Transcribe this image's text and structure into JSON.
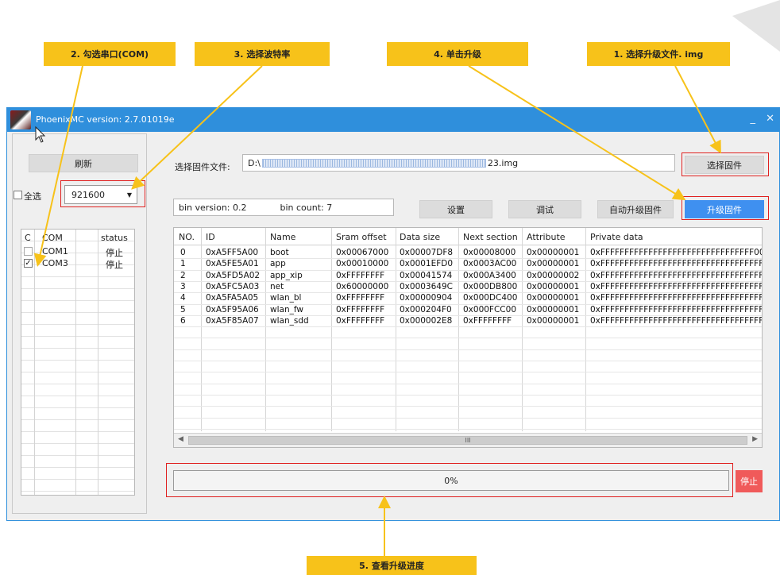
{
  "callouts": {
    "step1": "1. 选择升级文件. img",
    "step2": "2. 勾选串口(COM)",
    "step3": "3. 选择波特率",
    "step4": "4. 单击升级",
    "step5": "5. 查看升级进度"
  },
  "window": {
    "title": "PhoenixMC version: 2.7.01019e",
    "minimize": "_",
    "close": "✕"
  },
  "left_panel": {
    "refresh_label": "刷新",
    "select_all_label": "全选",
    "baud_rate": "921600",
    "columns": [
      "C",
      "COM",
      "status"
    ],
    "rows": [
      {
        "checked": false,
        "com": "COM1",
        "status": "停止"
      },
      {
        "checked": true,
        "com": "COM3",
        "status": "停止"
      }
    ]
  },
  "firmware": {
    "label": "选择固件文件:",
    "path_prefix": "D:\\",
    "path_suffix": "23.img",
    "select_button": "选择固件",
    "bin_version": "bin version: 0.2",
    "bin_count": "bin count: 7",
    "settings_button": "设置",
    "debug_button": "调试",
    "auto_upgrade_button": "自动升级固件",
    "upgrade_button": "升级固件"
  },
  "table": {
    "columns": [
      "NO.",
      "ID",
      "Name",
      "Sram offset",
      "Data size",
      "Next section",
      "Attribute",
      "Private data"
    ],
    "rows": [
      [
        "0",
        "0xA5FF5A00",
        "boot",
        "0x00067000",
        "0x00007DF8",
        "0x00008000",
        "0x00000001",
        "0xFFFFFFFFFFFFFFFFFFFFFFFFFFFFFFFF001("
      ],
      [
        "1",
        "0xA5FE5A01",
        "app",
        "0x00010000",
        "0x0001EFD0",
        "0x0003AC00",
        "0x00000001",
        "0xFFFFFFFFFFFFFFFFFFFFFFFFFFFFFFFFFFFFF"
      ],
      [
        "2",
        "0xA5FD5A02",
        "app_xip",
        "0xFFFFFFFF",
        "0x00041574",
        "0x000A3400",
        "0x00000002",
        "0xFFFFFFFFFFFFFFFFFFFFFFFFFFFFFFFFFFFFF"
      ],
      [
        "3",
        "0xA5FC5A03",
        "net",
        "0x60000000",
        "0x0003649C",
        "0x000DB800",
        "0x00000001",
        "0xFFFFFFFFFFFFFFFFFFFFFFFFFFFFFFFFFFFFF"
      ],
      [
        "4",
        "0xA5FA5A05",
        "wlan_bl",
        "0xFFFFFFFF",
        "0x00000904",
        "0x000DC400",
        "0x00000001",
        "0xFFFFFFFFFFFFFFFFFFFFFFFFFFFFFFFFFFFFF"
      ],
      [
        "5",
        "0xA5F95A06",
        "wlan_fw",
        "0xFFFFFFFF",
        "0x000204F0",
        "0x000FCC00",
        "0x00000001",
        "0xFFFFFFFFFFFFFFFFFFFFFFFFFFFFFFFFFFFFF"
      ],
      [
        "6",
        "0xA5F85A07",
        "wlan_sdd",
        "0xFFFFFFFF",
        "0x000002E8",
        "0xFFFFFFFF",
        "0x00000001",
        "0xFFFFFFFFFFFFFFFFFFFFFFFFFFFFFFFFFFFFF"
      ]
    ],
    "scroll_grip": "III"
  },
  "progress": {
    "text": "0%",
    "value": 0,
    "stop_button": "停止"
  },
  "colors": {
    "callout": "#f7c21a",
    "titlebar": "#2f8fdc",
    "highlight": "#e0201f",
    "upgrade_button": "#3f90f0",
    "stop_button": "#f05a5a"
  }
}
